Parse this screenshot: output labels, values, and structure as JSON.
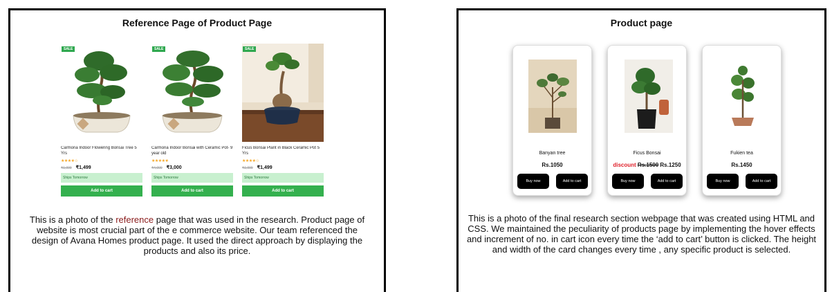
{
  "left_panel": {
    "title": "Reference Page of Product Page",
    "products": [
      {
        "badge": "SALE",
        "name": "Carmona Indoor Flowering Bonsai Tree 5 Yrs",
        "rating_stars": "★★★★☆",
        "old_price": "₹1,999",
        "price": "₹1,499",
        "shipping": "Ships Tomorrow",
        "cart_label": "Add to cart"
      },
      {
        "badge": "SALE",
        "name": "Carmona Indoor Bonsai with Ceramic Pot- 9 year old",
        "rating_stars": "★★★★★",
        "old_price": "₹4,000",
        "price": "₹3,000",
        "shipping": "Ships Tomorrow",
        "cart_label": "Add to cart"
      },
      {
        "badge": "SALE",
        "name": "Ficus Bonsai Plant in Black Ceramic Pot 5 Yrs",
        "rating_stars": "★★★★☆",
        "old_price": "₹1,999",
        "price": "₹1,499",
        "shipping": "Ships Tomorrow",
        "cart_label": "Add to cart"
      }
    ],
    "description": {
      "part1": "This is a photo of the ",
      "highlight": "reference",
      "part2": " page that was used in the research. Product page of website is most crucial part of the e commerce website. Our team referenced the design of Avana Homes product page. It used the direct approach by displaying the products and also its price."
    }
  },
  "right_panel": {
    "title": "Product page",
    "products": [
      {
        "name": "Banyan tree",
        "price": "Rs.1050",
        "buy_label": "Buy now",
        "cart_label": "Add to cart"
      },
      {
        "name": "Ficus Bonsai",
        "discount_label": "discount",
        "old_price": "Rs.1500",
        "price": "Rs.1250",
        "buy_label": "Buy now",
        "cart_label": "Add to cart"
      },
      {
        "name": "Fukien tea",
        "price": "Rs.1450",
        "buy_label": "Buy now",
        "cart_label": "Add to cart"
      }
    ],
    "description": "This is a photo of the final research section webpage that was created using HTML and CSS. We maintained the peculiarity of products page by implementing the hover effects and increment of no. in cart icon every time the ‘add to cart’ button is clicked. The height and width of the card changes every time , any specific product is selected."
  },
  "colors": {
    "sale_green": "#2fa84f",
    "cart_green": "#34b04e",
    "ships_bg": "#c8f0cf",
    "discount_red": "#e0202a",
    "accent_reference": "#8a1b1b"
  }
}
